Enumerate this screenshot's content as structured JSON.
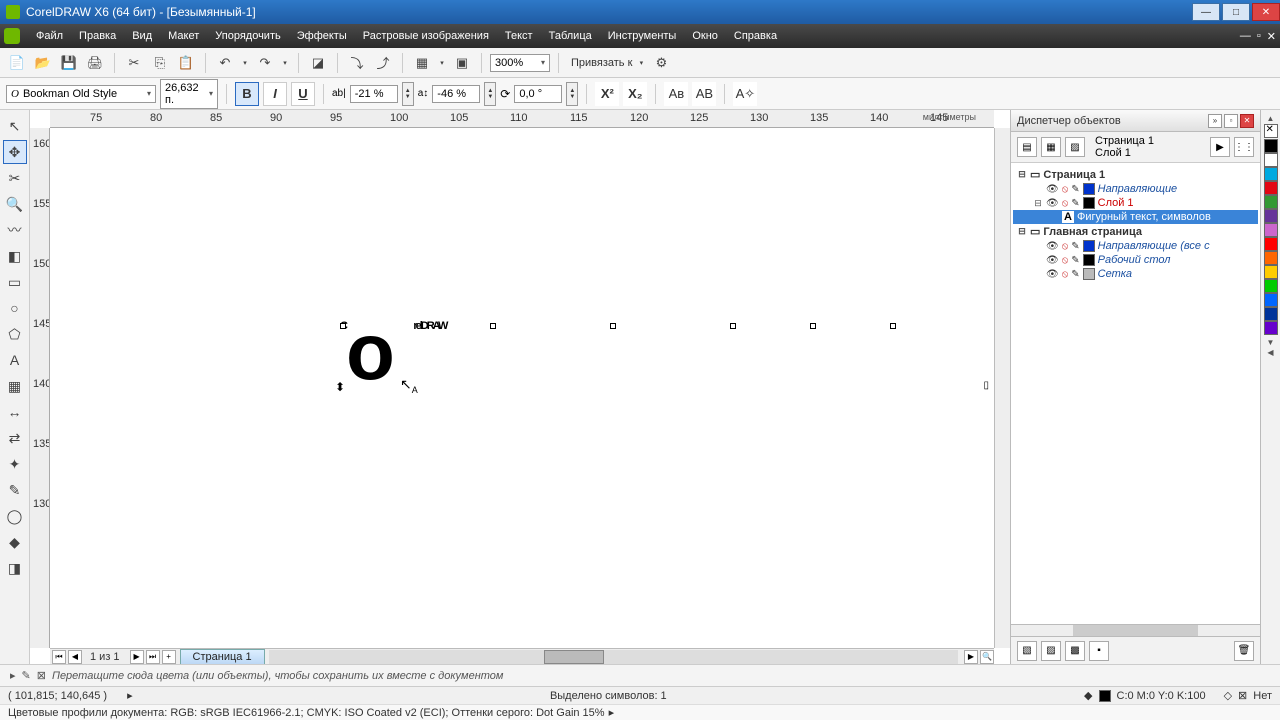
{
  "window": {
    "title": "CorelDRAW X6 (64 бит) - [Безымянный-1]"
  },
  "menu": [
    "Файл",
    "Правка",
    "Вид",
    "Макет",
    "Упорядочить",
    "Эффекты",
    "Растровые изображения",
    "Текст",
    "Таблица",
    "Инструменты",
    "Окно",
    "Справка"
  ],
  "toolbar": {
    "zoom": "300%",
    "snap": "Привязать к"
  },
  "prop": {
    "font": "Bookman Old Style",
    "size": "26,632 п.",
    "bold": "B",
    "italic": "I",
    "underline": "U",
    "kern_label": "ab|",
    "kern_val": "-21 %",
    "vshift_label": "a↕",
    "vshift_val": "-46 %",
    "rot_label": "⟳",
    "rot_val": "0,0 °",
    "sup": "X²",
    "sub": "X₂",
    "caps": "Ав",
    "caps2": "АВ",
    "charfx": "A✧"
  },
  "ruler": {
    "unit": "миллиметры",
    "h": [
      "75",
      "80",
      "85",
      "90",
      "95",
      "100",
      "105",
      "110",
      "115",
      "120",
      "125",
      "130",
      "135",
      "140",
      "145"
    ],
    "v": [
      "160",
      "155",
      "150",
      "145",
      "140",
      "135",
      "130"
    ]
  },
  "artwork": {
    "c": "C",
    "o": "o",
    "rest": "relDRAW"
  },
  "pagebar": {
    "count": "1 из 1",
    "tab": "Страница 1"
  },
  "panel": {
    "title": "Диспетчер объектов",
    "sub_page": "Страница 1",
    "sub_layer": "Слой 1",
    "rows": [
      {
        "ind": 0,
        "tw": "⊟",
        "bold": true,
        "label": "Страница 1",
        "swatch": null
      },
      {
        "ind": 1,
        "eye": true,
        "swatch": "#0033cc",
        "label": "Направляющие",
        "cls": "link"
      },
      {
        "ind": 1,
        "tw": "⊟",
        "eye": true,
        "swatch": "#000",
        "label": "Слой 1",
        "cls": "red"
      },
      {
        "ind": 2,
        "texticon": true,
        "sel": true,
        "label": "Фигурный текст, символов"
      },
      {
        "ind": 0,
        "tw": "⊟",
        "bold": true,
        "label": "Главная страница",
        "swatch": null
      },
      {
        "ind": 1,
        "eye": true,
        "swatch": "#0033cc",
        "label": "Направляющие (все с",
        "cls": "link"
      },
      {
        "ind": 1,
        "eye": true,
        "swatch": "#000",
        "label": "Рабочий стол",
        "cls": "link"
      },
      {
        "ind": 1,
        "eye": true,
        "swatch": "#bbb",
        "label": "Сетка",
        "cls": "link"
      }
    ]
  },
  "palette": [
    "#000000",
    "#ffffff",
    "#00a9e0",
    "#e30613",
    "#339933",
    "#663399",
    "#cc66cc",
    "#ff0000",
    "#ff6600",
    "#ffcc00",
    "#00cc00",
    "#0066ff",
    "#003399",
    "#6600cc"
  ],
  "colorwell": {
    "hint": "Перетащите сюда цвета (или объекты), чтобы сохранить их вместе с документом"
  },
  "status": {
    "coords": "( 101,815; 140,645 )",
    "sel": "Выделено символов: 1",
    "fill": "C:0 M:0 Y:0 K:100",
    "outline": "Нет"
  },
  "profiles": "Цветовые профили документа: RGB: sRGB IEC61966-2.1; CMYK: ISO Coated v2 (ECI); Оттенки серого: Dot Gain 15%"
}
